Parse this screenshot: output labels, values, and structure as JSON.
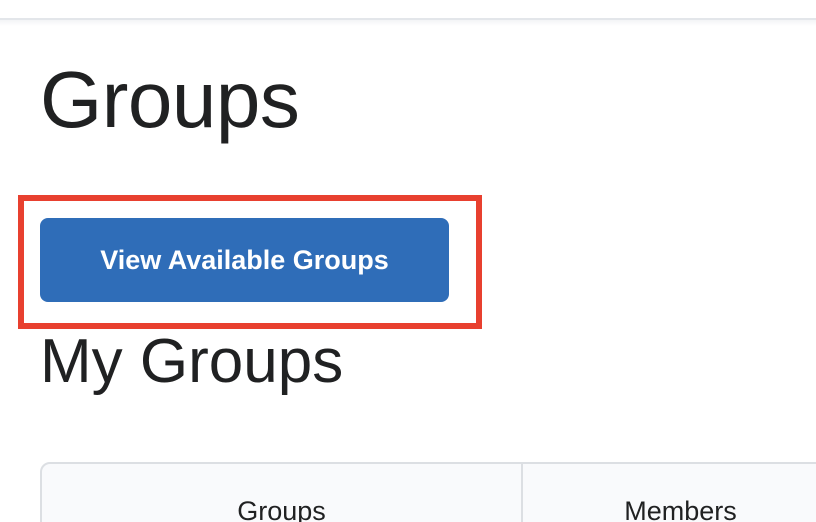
{
  "page": {
    "title": "Groups"
  },
  "actions": {
    "view_available_groups_label": "View Available Groups"
  },
  "my_groups": {
    "heading": "My Groups",
    "table": {
      "columns": [
        "Groups",
        "Members"
      ]
    }
  },
  "colors": {
    "primary_button": "#2f6db8",
    "highlight_outline": "#e8402f",
    "text": "#202122",
    "table_border": "#dcdfe3",
    "table_header_bg": "#f9fafc"
  }
}
